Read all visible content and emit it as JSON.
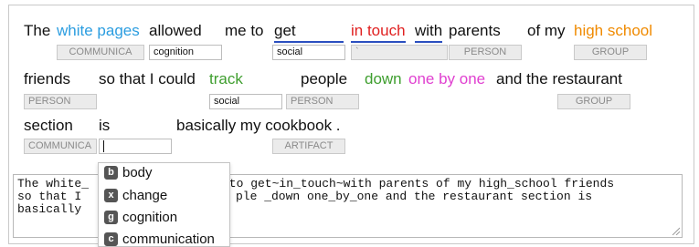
{
  "colors": {
    "blue": "#2b9de0",
    "red": "#e02020",
    "orange": "#f08a00",
    "green": "#3e9e2e",
    "magenta": "#e040d0",
    "underline": "#2a4fbf"
  },
  "line1": {
    "the": "The",
    "white_pages": "white pages",
    "allowed": "allowed",
    "me_to": "me to",
    "get": "get",
    "in_touch": "in touch",
    "with": "with",
    "parents": "parents",
    "of_my": "of my",
    "high_school": "high school"
  },
  "tags1": {
    "t1": "COMMUNICA",
    "t2": "cognition",
    "t3": "social",
    "t4": "`",
    "t5": "PERSON",
    "t6": "GROUP"
  },
  "line2": {
    "friends": "friends",
    "so_that": "so that I could",
    "track": "track",
    "people": "people",
    "down": "down",
    "one_by_one": "one by one",
    "rest": "and the restaurant"
  },
  "tags2": {
    "t1": "PERSON",
    "t2": "social",
    "t3": "PERSON",
    "t4": "GROUP"
  },
  "line3": {
    "section": "section",
    "is": "is",
    "cookbook": "basically my cookbook ."
  },
  "tags3": {
    "t1": "COMMUNICA",
    "t3": "ARTIFACT"
  },
  "textarea": {
    "line1a": "The white_",
    "line1b": " to get~in_touch~with parents of my high_school friends",
    "line2a": "so that I ",
    "line2b": "ple _down one_by_one and the restaurant section is",
    "line3a": "basically "
  },
  "menu": [
    {
      "icon": "b",
      "label": "body"
    },
    {
      "icon": "x",
      "label": "change"
    },
    {
      "icon": "g",
      "label": "cognition"
    },
    {
      "icon": "c",
      "label": "communication"
    }
  ]
}
